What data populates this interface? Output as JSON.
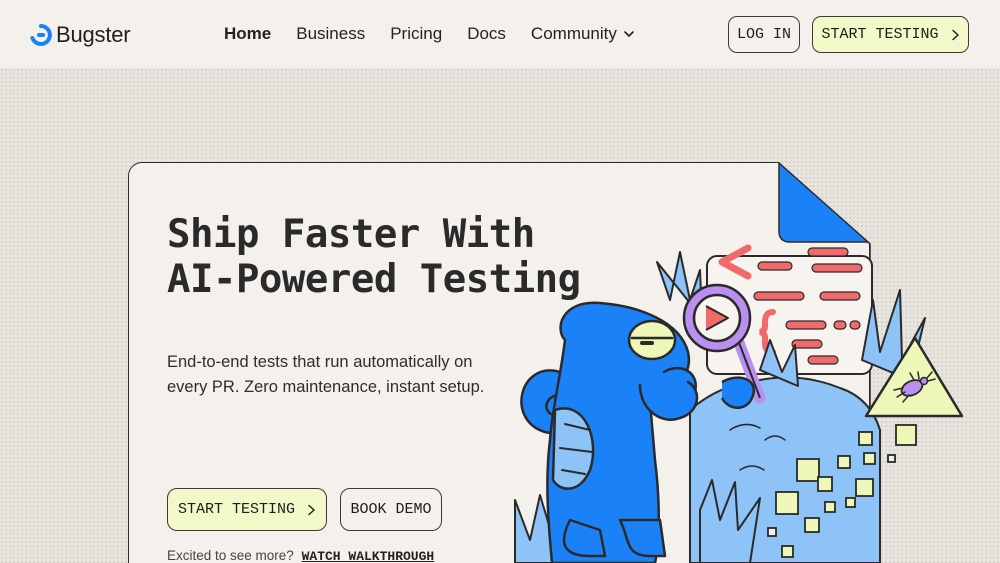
{
  "brand": {
    "name": "Bugster",
    "accent": "#1a82f6",
    "highlight": "#f3f8c8"
  },
  "nav": {
    "links": [
      {
        "label": "Home",
        "active": true
      },
      {
        "label": "Business"
      },
      {
        "label": "Pricing"
      },
      {
        "label": "Docs"
      },
      {
        "label": "Community",
        "icon": "chevron-down-icon"
      }
    ],
    "login_label": "LOG IN",
    "start_label": "START TESTING"
  },
  "hero": {
    "title_line1": "Ship Faster With",
    "title_line2": "AI-Powered Testing",
    "subtitle": "End-to-end tests that run automatically on every PR. Zero maintenance, instant setup.",
    "primary_cta": "START TESTING",
    "secondary_cta": "BOOK DEMO",
    "teaser_text": "Excited to see more?",
    "teaser_link": "WATCH WALKTHROUGH"
  },
  "illustration": {
    "subject": "chameleon-with-magnifying-glass",
    "colors": {
      "chameleon": "#1a82f6",
      "light_blue": "#8ec3f7",
      "code_red": "#f06a6a",
      "bug_yellow": "#eef7b8",
      "lens": "#b98ff0"
    }
  }
}
